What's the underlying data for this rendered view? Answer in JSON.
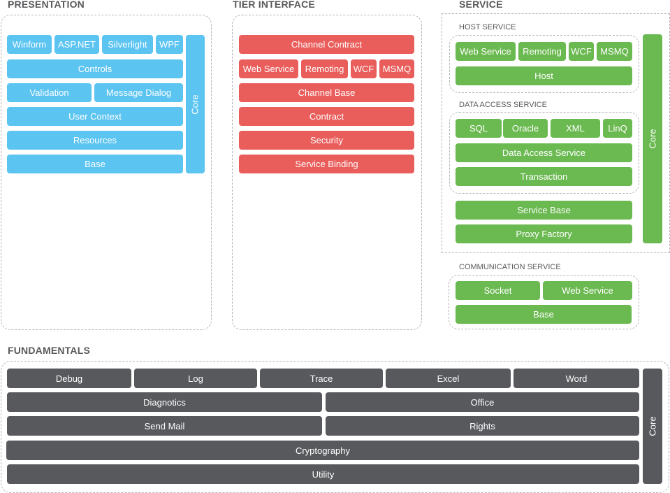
{
  "presentation": {
    "title": "PRESENTATION",
    "row1": [
      "Winform",
      "ASP.NET",
      "Silverlight",
      "WPF"
    ],
    "controls": "Controls",
    "row3": [
      "Validation",
      "Message Dialog"
    ],
    "user_context": "User Context",
    "resources": "Resources",
    "base": "Base",
    "core": "Core"
  },
  "tier_interface": {
    "title": "TIER INTERFACE",
    "channel_contract": "Channel Contract",
    "row2": [
      "Web Service",
      "Remoting",
      "WCF",
      "MSMQ"
    ],
    "channel_base": "Channel Base",
    "contract": "Contract",
    "security": "Security",
    "service_binding": "Service Binding"
  },
  "service": {
    "title": "SERVICE",
    "host_service": {
      "title": "HOST SERVICE",
      "row1": [
        "Web Service",
        "Remoting",
        "WCF",
        "MSMQ"
      ],
      "host": "Host"
    },
    "data_access_service": {
      "title": "DATA ACCESS SERVICE",
      "row1": [
        "SQL",
        "Oracle",
        "XML",
        "LinQ"
      ],
      "data_access": "Data Access Service",
      "transaction": "Transaction"
    },
    "service_base": "Service Base",
    "proxy_factory": "Proxy Factory",
    "core": "Core",
    "communication_service": {
      "title": "COMMUNICATION SERVICE",
      "row1": [
        "Socket",
        "Web Service"
      ],
      "base": "Base"
    }
  },
  "fundamentals": {
    "title": "FUNDAMENTALS",
    "row1": [
      "Debug",
      "Log",
      "Trace",
      "Excel",
      "Word"
    ],
    "diagnotics": "Diagnotics",
    "office": "Office",
    "send_mail": "Send Mail",
    "rights": "Rights",
    "cryptography": "Cryptography",
    "utility": "Utility",
    "core": "Core"
  },
  "colors": {
    "presentation": "#5bc4f1",
    "tier_interface": "#e95d5b",
    "service": "#6bb951",
    "fundamentals": "#58595d",
    "heading": "#58595b"
  }
}
